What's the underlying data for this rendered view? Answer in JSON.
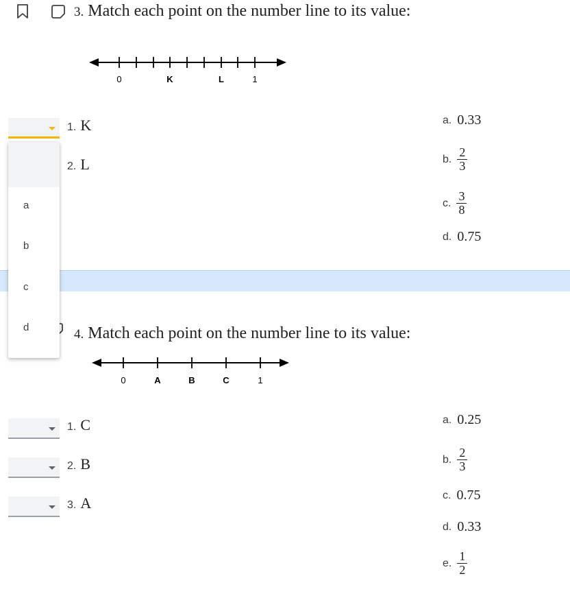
{
  "question3": {
    "number": "3.",
    "title": "Match each point on the number line to its value:",
    "number_line_labels": [
      "0",
      "K",
      "L",
      "1"
    ],
    "prompts": [
      {
        "label": "1.",
        "text": "K"
      },
      {
        "label": "2.",
        "text": "L"
      }
    ],
    "answers": [
      {
        "label": "a.",
        "value": "0.33"
      },
      {
        "label": "b.",
        "numerator": "2",
        "denominator": "3"
      },
      {
        "label": "c.",
        "numerator": "3",
        "denominator": "8"
      },
      {
        "label": "d.",
        "value": "0.75"
      }
    ],
    "dropdown_options": [
      "a",
      "b",
      "c",
      "d"
    ]
  },
  "question4": {
    "number": "4.",
    "title": "Match each point on the number line to its value:",
    "number_line_labels": [
      "0",
      "A",
      "B",
      "C",
      "1"
    ],
    "prompts": [
      {
        "label": "1.",
        "text": "C"
      },
      {
        "label": "2.",
        "text": "B"
      },
      {
        "label": "3.",
        "text": "A"
      }
    ],
    "answers": [
      {
        "label": "a.",
        "value": "0.25"
      },
      {
        "label": "b.",
        "numerator": "2",
        "denominator": "3"
      },
      {
        "label": "c.",
        "value": "0.75"
      },
      {
        "label": "d.",
        "value": "0.33"
      },
      {
        "label": "e.",
        "numerator": "1",
        "denominator": "2"
      }
    ]
  },
  "icons": {
    "bookmark": "bookmark-icon",
    "comment": "comment-icon"
  },
  "colors": {
    "accent": "#f4b400",
    "separator": "#d6e8fb",
    "dropdown_fill": "#f1f3f4"
  }
}
